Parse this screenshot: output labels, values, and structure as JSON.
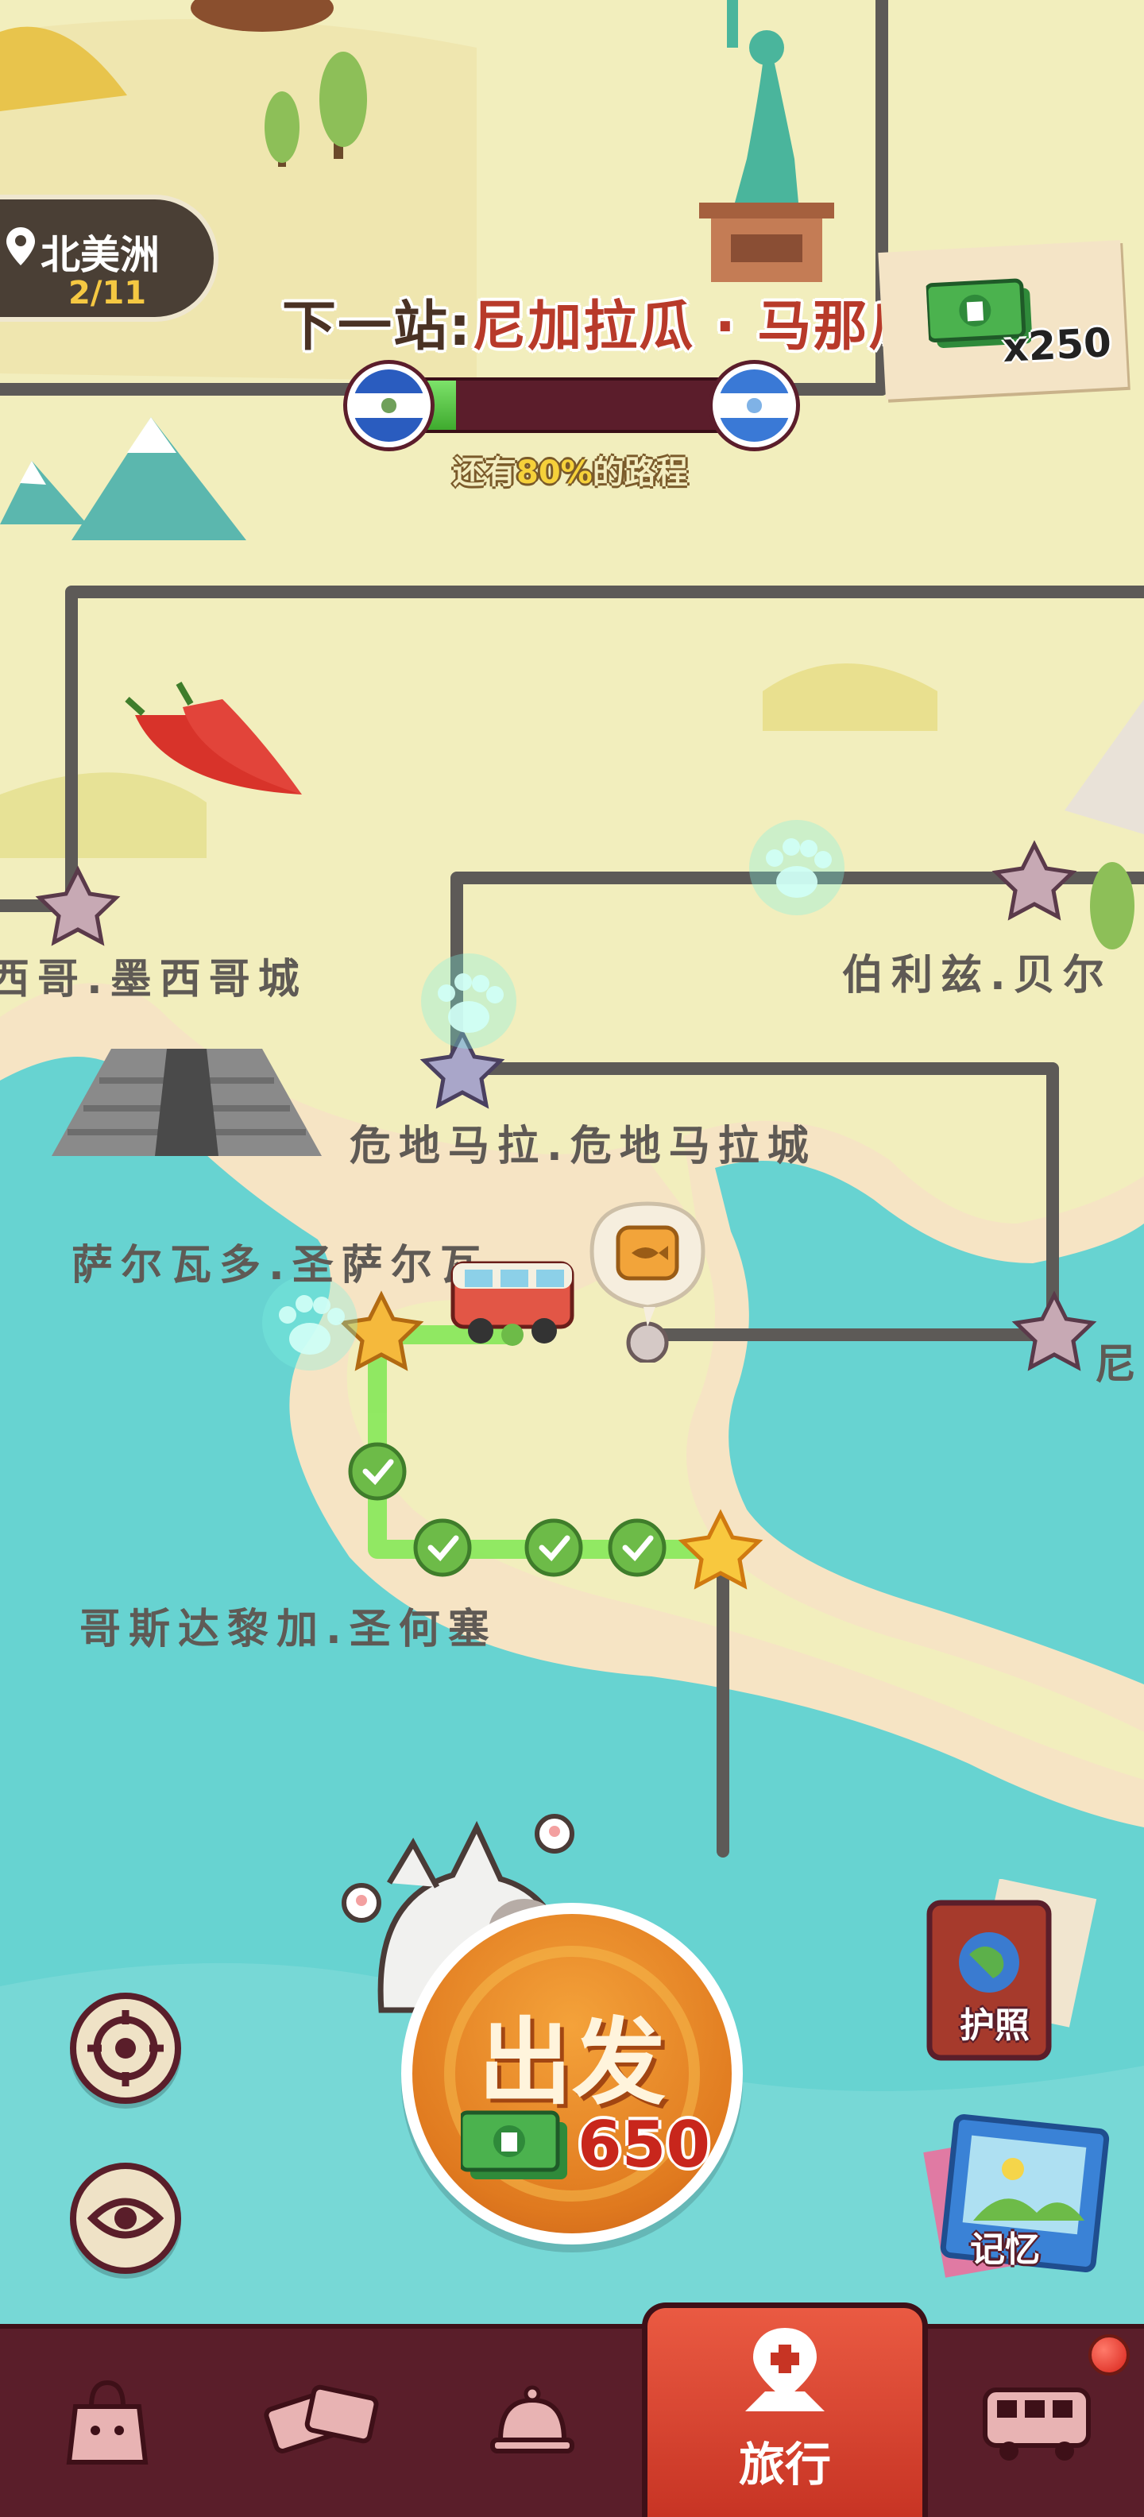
{
  "region": {
    "name": "北美洲",
    "progress": "2/11"
  },
  "next_stop": {
    "prefix": "下一站:",
    "name": "尼加拉瓜 · 马那瓜"
  },
  "route_progress": {
    "fraction_done": 0.2,
    "remain_prefix": "还有",
    "remain_pct": "80%",
    "remain_suffix": "的路程"
  },
  "cash": {
    "count": "x250"
  },
  "cities": {
    "mexico": "西哥.墨西哥城",
    "belize": "伯利兹.贝尔",
    "guatemala": "危地马拉.危地马拉城",
    "el_salvador": "萨尔瓦多.圣萨尔瓦",
    "nicaragua": "尼",
    "costa_rica": "哥斯达黎加.圣何塞"
  },
  "depart": {
    "label": "出发",
    "cost": "650"
  },
  "side_buttons": {
    "passport": "护照",
    "memory": "记忆"
  },
  "nav": {
    "travel": "旅行"
  },
  "icons": [
    "location-pin-icon",
    "flag-el-salvador-icon",
    "flag-nicaragua-icon",
    "cash-icon",
    "target-icon",
    "eye-icon",
    "passport-icon",
    "memory-photo-icon",
    "bag-icon",
    "tickets-icon",
    "service-bell-icon",
    "travel-map-icon",
    "bus-icon"
  ],
  "colors": {
    "accent": "#e07a1f",
    "nav_bg": "#5a1e2a",
    "route_done": "#7ddc4e",
    "sea": "#67d3d1"
  }
}
